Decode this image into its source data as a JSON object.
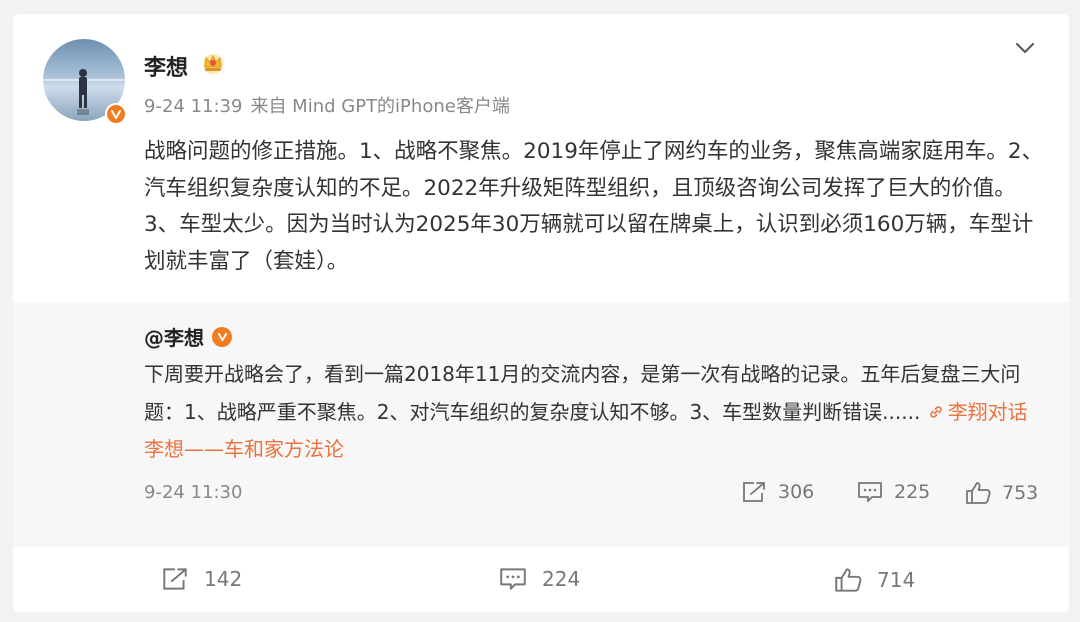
{
  "post": {
    "username": "李想",
    "time": "9-24 11:39",
    "source": "来自 Mind GPT的iPhone客户端",
    "text": "战略问题的修正措施。1、战略不聚焦。2019年停止了网约车的业务，聚焦高端家庭用车。2、汽车组织复杂度认知的不足。2022年升级矩阵型组织，且顶级咨询公司发挥了巨大的价值。3、车型太少。因为当时认为2025年30万辆就可以留在牌桌上，认识到必须160万辆，车型计划就丰富了（套娃）。"
  },
  "quoted": {
    "username": "@李想",
    "text": "下周要开战略会了，看到一篇2018年11月的交流内容，是第一次有战略的记录。五年后复盘三大问题：1、战略严重不聚焦。2、对汽车组织的复杂度认知不够。3、车型数量判断错误...... ",
    "link_text": "李翔对话李想——车和家方法论",
    "time": "9-24 11:30",
    "shares": "306",
    "comments": "225",
    "likes": "753"
  },
  "footer": {
    "shares": "142",
    "comments": "224",
    "likes": "714"
  },
  "colors": {
    "accent": "#eb7340",
    "verified_badge": "#f27d21"
  },
  "icons": [
    "chevron-down-icon",
    "crown-icon",
    "verified-badge-icon",
    "link-icon",
    "share-icon",
    "comment-icon",
    "like-icon"
  ]
}
